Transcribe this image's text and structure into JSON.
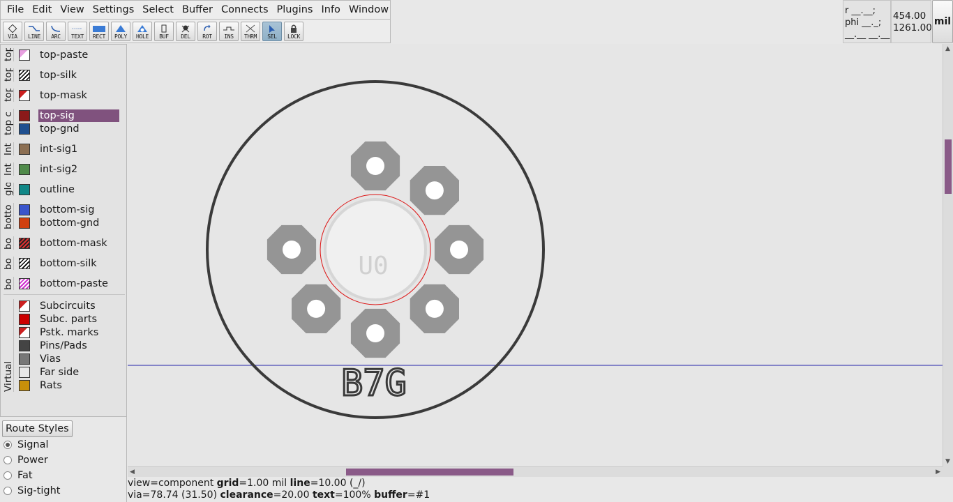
{
  "menu": [
    "File",
    "Edit",
    "View",
    "Settings",
    "Select",
    "Buffer",
    "Connects",
    "Plugins",
    "Info",
    "Window"
  ],
  "tools": [
    {
      "label": "VIA",
      "icon": "via-icon"
    },
    {
      "label": "LINE",
      "icon": "line-icon"
    },
    {
      "label": "ARC",
      "icon": "arc-icon"
    },
    {
      "label": "TEXT",
      "icon": "text-icon"
    },
    {
      "label": "RECT",
      "icon": "rect-icon"
    },
    {
      "label": "POLY",
      "icon": "poly-icon"
    },
    {
      "label": "HOLE",
      "icon": "hole-icon"
    },
    {
      "label": "BUF",
      "icon": "buffer-icon"
    },
    {
      "label": "DEL",
      "icon": "delete-icon"
    },
    {
      "label": "ROT",
      "icon": "rotate-icon"
    },
    {
      "label": "INS",
      "icon": "insert-icon"
    },
    {
      "label": "THRM",
      "icon": "thermal-icon"
    },
    {
      "label": "SEL",
      "icon": "select-icon",
      "active": true
    },
    {
      "label": "LOCK",
      "icon": "lock-icon"
    }
  ],
  "polar": {
    "r": "r __.__;",
    "phi": "phi __._;",
    "line3": "__.__ __.__"
  },
  "coords": {
    "x": "454.00",
    "y": "1261.00"
  },
  "unit": "mil",
  "layer_groups": [
    {
      "tab": "top",
      "layers": [
        {
          "name": "top-paste",
          "color": "#e8a0e0",
          "style": "corner"
        }
      ]
    },
    {
      "tab": "top",
      "layers": [
        {
          "name": "top-silk",
          "color": "#000000",
          "style": "hatch"
        }
      ]
    },
    {
      "tab": "top",
      "layers": [
        {
          "name": "top-mask",
          "color": "#cc2020",
          "style": "corner"
        }
      ]
    },
    {
      "tab": "top c",
      "layers": [
        {
          "name": "top-sig",
          "color": "#8b1a1a",
          "selected": true
        },
        {
          "name": "top-gnd",
          "color": "#1f4f8f"
        }
      ]
    },
    {
      "tab": "Int",
      "layers": [
        {
          "name": "int-sig1",
          "color": "#8b6e52"
        }
      ]
    },
    {
      "tab": "Int",
      "layers": [
        {
          "name": "int-sig2",
          "color": "#4f8a4a"
        }
      ]
    },
    {
      "tab": "glo",
      "layers": [
        {
          "name": "outline",
          "color": "#118888"
        }
      ]
    },
    {
      "tab": "botto",
      "layers": [
        {
          "name": "bottom-sig",
          "color": "#3a55cc"
        },
        {
          "name": "bottom-gnd",
          "color": "#d04010"
        }
      ]
    },
    {
      "tab": "bo",
      "layers": [
        {
          "name": "bottom-mask",
          "color": "#e03030",
          "style": "hatch-red"
        }
      ]
    },
    {
      "tab": "bo",
      "layers": [
        {
          "name": "bottom-silk",
          "color": "#000000",
          "style": "hatch"
        }
      ]
    },
    {
      "tab": "bo",
      "layers": [
        {
          "name": "bottom-paste",
          "color": "#d030d0",
          "style": "hatch-mag"
        }
      ]
    }
  ],
  "virtual_tab": "Virtual",
  "virtual_layers": [
    {
      "name": "Subcircuits",
      "color": "#cc2020",
      "style": "corner"
    },
    {
      "name": "Subc. parts",
      "color": "#cc0000"
    },
    {
      "name": "Pstk. marks",
      "color": "#cc2020",
      "style": "corner"
    },
    {
      "name": "Pins/Pads",
      "color": "#444444"
    },
    {
      "name": "Vias",
      "color": "#777777"
    },
    {
      "name": "Far side",
      "color": "#e8e8e8"
    },
    {
      "name": "Rats",
      "color": "#c8900a"
    }
  ],
  "route_styles": {
    "button": "Route Styles",
    "options": [
      {
        "label": "Signal",
        "checked": true
      },
      {
        "label": "Power",
        "checked": false
      },
      {
        "label": "Fat",
        "checked": false
      },
      {
        "label": "Sig-tight",
        "checked": false
      }
    ]
  },
  "canvas": {
    "refdes": "U0",
    "footprint_label": "B7G",
    "pad_count": 7
  },
  "status": {
    "view_key": "view",
    "view_val": "component",
    "grid_key": "grid",
    "grid_val": "1.00 mil",
    "line_key": "line",
    "line_val": "10.00 (_/)",
    "via_key": "via",
    "via_val": "78.74 (31.50)",
    "clearance_key": "clearance",
    "clearance_val": "20.00",
    "text_key": "text",
    "text_val": "100%",
    "buffer_key": "buffer",
    "buffer_val": "#1"
  }
}
